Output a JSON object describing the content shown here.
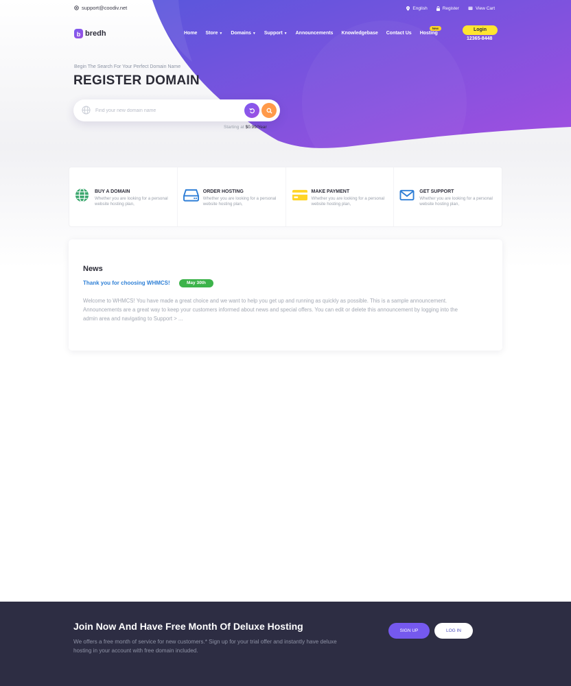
{
  "topbar": {
    "email": "support@coodiv.net",
    "language": "English",
    "register": "Register",
    "cart": "View Cart"
  },
  "brand": {
    "name": "bredh",
    "mark": "b"
  },
  "nav": {
    "home": "Home",
    "store": "Store",
    "domains": "Domains",
    "support": "Support",
    "announcements": "Announcements",
    "knowledgebase": "Knowledgebase",
    "contact": "Contact Us",
    "hosting": "Hosting",
    "hosting_badge": "New",
    "login": "Login",
    "phone": "12365-8448"
  },
  "hero": {
    "subtitle": "Begin The Search For Your Perfect Domain Name",
    "title": "REGISTER DOMAIN",
    "search_placeholder": "Find your new domain name",
    "starting_prefix": "Starting at",
    "starting_price": "$0.99/Year"
  },
  "features": [
    {
      "title": "BUY A DOMAIN",
      "desc": "Whether you are looking for a personal website hosting plan,",
      "icon": "globe-icon"
    },
    {
      "title": "ORDER HOSTING",
      "desc": "Whether you are looking for a personal website hosting plan,",
      "icon": "server-icon"
    },
    {
      "title": "MAKE PAYMENT",
      "desc": "Whether you are looking for a personal website hosting plan,",
      "icon": "credit-card-icon"
    },
    {
      "title": "GET SUPPORT",
      "desc": "Whether you are looking for a personal website hosting plan,",
      "icon": "envelope-icon"
    }
  ],
  "news": {
    "heading": "News",
    "link": "Thank you for choosing WHMCS!",
    "date": "May 30th",
    "body": "Welcome to WHMCS! You have made a great choice and we want to help you get up and running as quickly as possible. This is a sample announcement. Announcements are a great way to keep your customers informed about news and special offers. You can edit or delete this announcement by logging into the admin area and navigating to Support > ..."
  },
  "cta": {
    "title": "Join Now And Have Free Month Of Deluxe Hosting",
    "text": "We offers a free month of service for new customers.* Sign up for your trial offer and instantly have deluxe hosting in your account with free domain included.",
    "signup": "SIGN UP",
    "login": "LOG IN"
  },
  "colors": {
    "purple": "#7559ee",
    "gradient_start": "#5a56dc",
    "gradient_end": "#a24fe0",
    "accent_yellow": "#ffe430",
    "search_orange": "#ff9a4a",
    "news_link": "#2f80d6",
    "date_badge": "#3cb34a",
    "footer_bg": "#2d2d43"
  }
}
